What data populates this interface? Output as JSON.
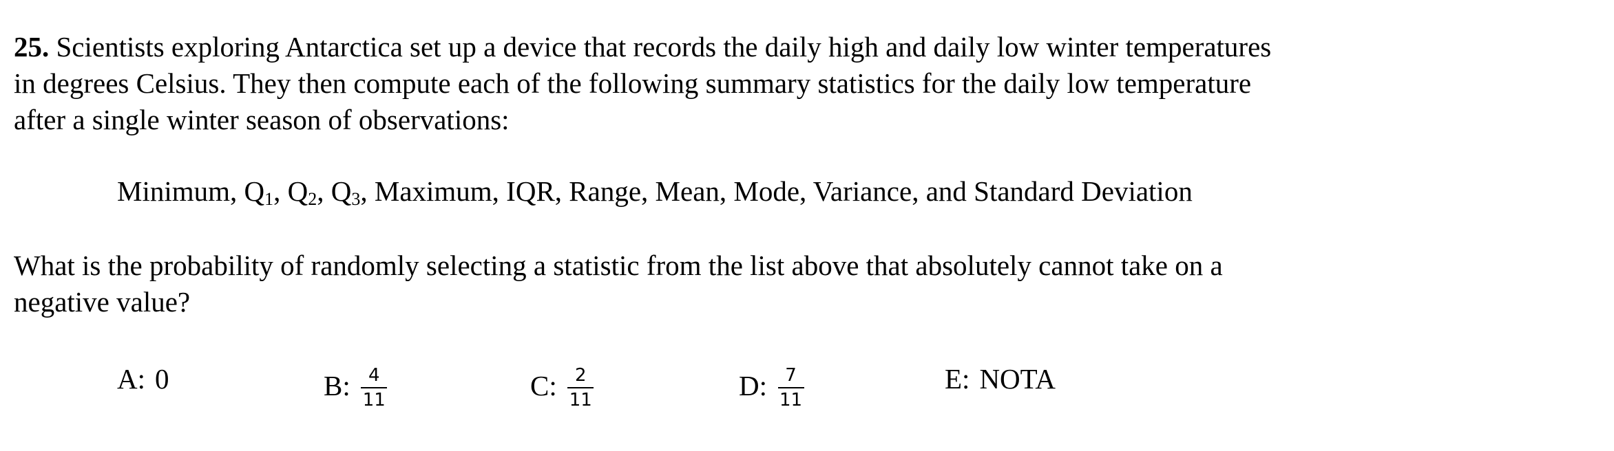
{
  "problem": {
    "number": "25.",
    "line1": " Scientists exploring Antarctica set up a device that records the daily high and daily low winter temperatures",
    "line2": "in degrees Celsius.  They then compute each of the following summary statistics for the daily low temperature",
    "line3": "after a single winter season of observations:"
  },
  "statistics": {
    "before_q": "Minimum, Q",
    "q1_sub": "1",
    "q2_prefix": ", Q",
    "q2_sub": "2",
    "q3_prefix": ", Q",
    "q3_sub": "3",
    "after_q": ", Maximum, IQR, Range, Mean, Mode, Variance, and Standard Deviation"
  },
  "question": {
    "line1": "What is the probability of randomly selecting a statistic from the list above that absolutely cannot take on a",
    "line2": "negative value?"
  },
  "choices": {
    "a": {
      "letter": "A:",
      "value": "0"
    },
    "b": {
      "letter": "B:",
      "numerator": "4",
      "denominator": "11"
    },
    "c": {
      "letter": "C:",
      "numerator": "2",
      "denominator": "11"
    },
    "d": {
      "letter": "D:",
      "numerator": "7",
      "denominator": "11"
    },
    "e": {
      "letter": "E:",
      "value": "NOTA"
    }
  }
}
